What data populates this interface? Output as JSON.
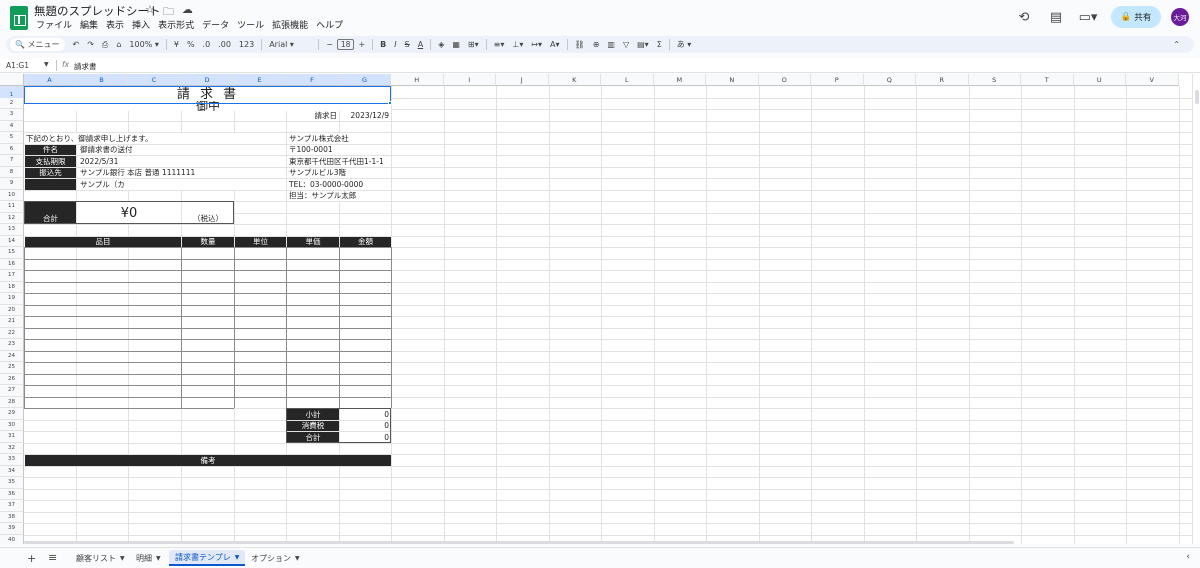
{
  "app": {
    "doc_title": "無題のスプレッドシート",
    "title_icons": [
      "star-icon",
      "folder-move-icon",
      "cloud-status-icon"
    ],
    "menu": [
      "ファイル",
      "編集",
      "表示",
      "挿入",
      "表示形式",
      "データ",
      "ツール",
      "拡張機能",
      "ヘルプ"
    ],
    "share_label": "共有",
    "avatar_label": "大河",
    "accent": "#0b57d0",
    "brand_green": "#0f9d58"
  },
  "toolbar": {
    "search": "メニュー",
    "zoom": "100%",
    "currency": "¥",
    "percent": "%",
    "decimal_dec": ".0",
    "decimal_inc": ".00",
    "format_123": "123",
    "font": "Arial",
    "font_size": "18",
    "minus": "−",
    "plus": "+",
    "bold": "B",
    "italic": "I",
    "strike": "S",
    "text_color": "A",
    "input_tool": "あ"
  },
  "formula": {
    "cell_ref": "A1:G1",
    "content": "請求書"
  },
  "columns": [
    "A",
    "B",
    "C",
    "D",
    "E",
    "F",
    "G",
    "H",
    "I",
    "J",
    "K",
    "L",
    "M",
    "N",
    "O",
    "P",
    "Q",
    "R",
    "S",
    "T",
    "U",
    "V"
  ],
  "invoice": {
    "title": "請 求 書",
    "recipient_suffix": "御中",
    "date_label": "請求日",
    "date_value": "2023/12/9",
    "intro": "下記のとおり、御請求申し上げます。",
    "fields": [
      {
        "label": "件名",
        "value": "御請求書の送付"
      },
      {
        "label": "支払期限",
        "value": "2022/5/31"
      },
      {
        "label": "振込先",
        "value": "サンプル銀行 本店 普通 1111111"
      },
      {
        "label": "",
        "value": "サンプル（カ"
      }
    ],
    "company": [
      "サンプル株式会社",
      "〒100-0001",
      "東京都千代田区千代田1-1-1",
      "サンプルビル3階",
      "TEL：03-0000-0000",
      "担当：サンプル太郎"
    ],
    "total_label": "合計",
    "total_value": "¥0",
    "tax_note": "（税込）",
    "table_headers": {
      "item": "品目",
      "qty": "数量",
      "unit": "単位",
      "price": "単価",
      "amount": "金額"
    },
    "summary": [
      {
        "label": "小計",
        "value": "0"
      },
      {
        "label": "消費税",
        "value": "0"
      },
      {
        "label": "合計",
        "value": "0"
      }
    ],
    "notes_label": "備考"
  },
  "tabs": [
    {
      "label": "顧客リスト",
      "active": false
    },
    {
      "label": "明細",
      "active": false
    },
    {
      "label": "請求書テンプレ",
      "active": true
    },
    {
      "label": "オプション",
      "active": false
    }
  ]
}
